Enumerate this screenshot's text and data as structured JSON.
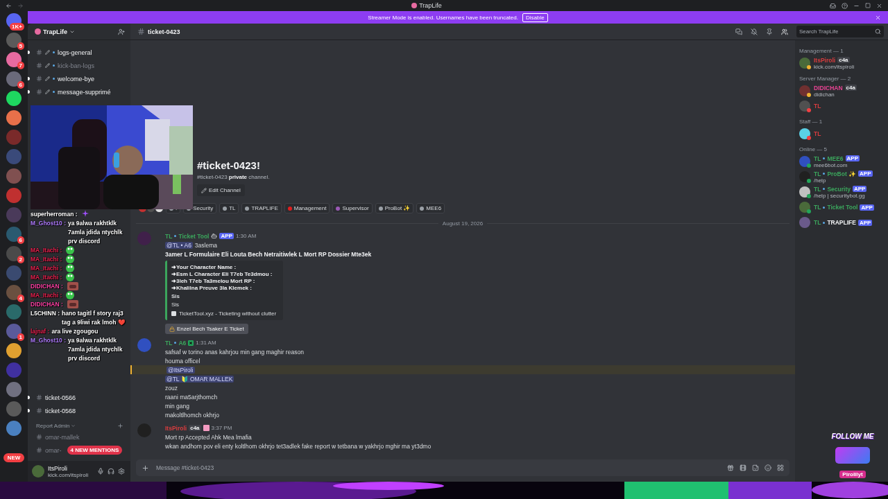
{
  "window": {
    "title": "TrapLife"
  },
  "banner": {
    "text": "Streamer Mode is enabled. Usernames have been truncated.",
    "button": "Disable"
  },
  "servers": [
    {
      "kind": "home",
      "badge": "1K+"
    },
    {
      "kind": "server",
      "badge": "5"
    },
    {
      "kind": "server",
      "badge": "7"
    },
    {
      "kind": "server",
      "badge": "6"
    },
    {
      "kind": "server"
    },
    {
      "kind": "server"
    },
    {
      "kind": "server"
    },
    {
      "kind": "server"
    },
    {
      "kind": "server"
    },
    {
      "kind": "server"
    },
    {
      "kind": "server"
    },
    {
      "kind": "server",
      "badge": "6"
    },
    {
      "kind": "server",
      "badge": "2"
    },
    {
      "kind": "server"
    },
    {
      "kind": "server",
      "badge": "4"
    },
    {
      "kind": "server"
    },
    {
      "kind": "server",
      "badge": "1"
    },
    {
      "kind": "server"
    },
    {
      "kind": "server"
    },
    {
      "kind": "server"
    },
    {
      "kind": "server"
    },
    {
      "kind": "server"
    }
  ],
  "new_pill": "NEW",
  "sidebar": {
    "server": "TrapLife",
    "channels_top": [
      {
        "name": "logs-general",
        "unread": true
      },
      {
        "name": "kick-ban-logs",
        "unread": false
      },
      {
        "name": "welcome-bye",
        "unread": true
      },
      {
        "name": "message-supprimé",
        "unread": true
      }
    ],
    "channels_bottom": [
      {
        "name": "ticket-0566",
        "unread": true
      },
      {
        "name": "ticket-0568",
        "unread": true
      }
    ],
    "category": "Report Admin",
    "category_channels": [
      {
        "name": "omar-mallek",
        "unread": false
      },
      {
        "name": "omar-",
        "unread": false
      }
    ],
    "mentions_pill": "4 NEW MENTIONS"
  },
  "user_panel": {
    "name": "ItsPiroli",
    "status": "kick.com/itspiroli"
  },
  "header": {
    "channel": "ticket-0423",
    "search_placeholder": "Search TrapLife"
  },
  "welcome": {
    "title": "#ticket-0423!",
    "text": "#ticket-0423 **private** channel.",
    "button": "Edit Channel"
  },
  "roles": [
    {
      "name": ".",
      "color": "#9aa0a6"
    },
    {
      "name": "Security",
      "color": "#9aa0a6"
    },
    {
      "name": "TL",
      "color": "#9aa0a6"
    },
    {
      "name": "TRAPLIFE",
      "color": "#9aa0a6"
    },
    {
      "name": "Management",
      "color": "#e01e1e"
    },
    {
      "name": "Supervisor",
      "color": "#9b59b6"
    },
    {
      "name": "ProBot ✨",
      "color": "#9aa0a6"
    },
    {
      "name": "MEE6",
      "color": "#9aa0a6"
    }
  ],
  "date": "August 19, 2026",
  "messages": [
    {
      "kind": "bot",
      "tag": "TL",
      "name": "Ticket Tool",
      "color": "#3ba55c",
      "app": "APP",
      "time": "1:30 AM",
      "lines": [
        {
          "kind": "mention",
          "mention": "@TL • A6",
          "text": "3aslema",
          "highlighted": false
        },
        {
          "kind": "bold",
          "text": "3amer L Formulaire Eli Louta Bech Netraitiwlek L Mort RP Dossier Mte3ek"
        }
      ],
      "embed": {
        "fields": [
          "➜Your Character Name :",
          "➜Esm L Character Eli T7eb Te3dmou :",
          "➜3leh T7eb Ta3melou Mort RP :",
          "➜Khalilna Preuve 3la Klemek :"
        ],
        "value_bold": "Sis",
        "value": "Sis",
        "footer": "TicketTool.xyz - Ticketing without clutter"
      },
      "button": "Enzel Bech Tsaker E Ticket"
    },
    {
      "kind": "staff",
      "tag": "TL",
      "name": "A6",
      "color": "#3ba55c",
      "time": "1:31 AM",
      "lines": [
        {
          "kind": "text",
          "text": "safsaf w torino anas kahrjou min gang maghir reason"
        },
        {
          "kind": "text",
          "text": "houma officel"
        },
        {
          "kind": "mention",
          "mention": "@ItsPiroli",
          "highlighted": true
        },
        {
          "kind": "mention",
          "mention": "@TL 🔰 OMAR MALLEK",
          "highlighted": false
        },
        {
          "kind": "text",
          "text": "zouz"
        },
        {
          "kind": "text",
          "text": "raani ma5arjthomch"
        },
        {
          "kind": "text",
          "text": "min gang"
        },
        {
          "kind": "text",
          "text": "makoltlhomch okhrjo"
        }
      ]
    },
    {
      "kind": "user",
      "name": "ItsPiroli",
      "color": "#d83c3e",
      "guild_tag": "c4a",
      "time": "3:37 PM",
      "lines": [
        {
          "kind": "text",
          "text": "Mort rp Accepted Ahk Mea lmafia"
        },
        {
          "kind": "text",
          "text": "wkan andhom pov eli enty koltlhom okhrjo tet3adlek fake report w tetbana w yakhrjo mghir ma yt3dmo"
        }
      ]
    }
  ],
  "input_placeholder": "Message #ticket-0423",
  "member_groups": [
    {
      "title": "Management — 1",
      "members": [
        {
          "name": "ItsPiroli",
          "color": "#d83c3e",
          "guild_tag": "c4a",
          "status": "kick.com/itspiroli",
          "presence": {
            "color": "#f0b232"
          }
        }
      ]
    },
    {
      "title": "Server Manager — 2",
      "members": [
        {
          "name": "DIDICHAN",
          "color": "#e84393",
          "guild_tag": "c4a",
          "status": "didichan",
          "presence": {
            "color": "#f0b232"
          }
        },
        {
          "prefix": "TL",
          "color": "#d83c3e",
          "presence": {
            "color": "#f23f43"
          }
        }
      ]
    },
    {
      "title": "Staff — 1",
      "members": [
        {
          "prefix": "TL",
          "color": "#d83c3e",
          "presence": {
            "color": "#f23f43"
          }
        }
      ]
    },
    {
      "title": "Online — 5",
      "members": [
        {
          "prefix": "TL",
          "name": "MEE6",
          "color": "#3ba55c",
          "app": "APP",
          "status": "mee6bot.com",
          "presence": {
            "color": "#23a55a"
          }
        },
        {
          "prefix": "TL",
          "name": "ProBot ✨",
          "color": "#3ba55c",
          "app": "APP",
          "status": "/help",
          "presence": {
            "color": "#23a55a"
          }
        },
        {
          "prefix": "TL",
          "name": "Security",
          "color": "#3ba55c",
          "app": "APP",
          "status": "/help | securitybot.gg",
          "presence": {
            "color": "#23a55a"
          }
        },
        {
          "prefix": "TL",
          "name": "Ticket Tool",
          "color": "#3ba55c",
          "app": "APP",
          "presence": {
            "color": "#23a55a"
          }
        },
        {
          "prefix": "TL",
          "name": "TRAPLIFE",
          "color": "#f2f3f5",
          "app": "APP"
        }
      ]
    }
  ],
  "stream_chat": [
    {
      "user": "superherroman :",
      "color": "#ffffff",
      "emote": {
        "kind": "sparkle"
      }
    },
    {
      "user": "M_Ghost10 :",
      "color": "#b07cff",
      "text": "ya 9alwa rakhtklk 7amla jdida ntychlk prv discord"
    },
    {
      "user": "MA_Itachi :",
      "color": "#e8214f",
      "emote": {
        "kind": "frog"
      }
    },
    {
      "user": "MA_Itachi :",
      "color": "#e8214f",
      "emote": {
        "kind": "frog"
      }
    },
    {
      "user": "MA_Itachi :",
      "color": "#e8214f",
      "emote": {
        "kind": "frog"
      }
    },
    {
      "user": "MA_Itachi :",
      "color": "#e8214f",
      "emote": {
        "kind": "frog"
      }
    },
    {
      "user": "DIDICHAN :",
      "color": "#ff3fa4",
      "emote": {
        "kind": "face"
      }
    },
    {
      "user": "MA_Itachi :",
      "color": "#e8214f",
      "emote": {
        "kind": "frog"
      }
    },
    {
      "user": "DIDICHAN :",
      "color": "#ff3fa4",
      "emote": {
        "kind": "face"
      }
    },
    {
      "user": "L5CHINN :",
      "color": "#ffffff",
      "text": "hano tagitl f story raj3 tag a 9liwi rak lmoh ❤️"
    },
    {
      "user": "lajnaf :",
      "color": "#e8214f",
      "text": "ara live zgougou"
    },
    {
      "user": "M_Ghost10 :",
      "color": "#b07cff",
      "text": "ya 9alwa rakhtklk 7amla jdida ntychlk prv discord"
    }
  ],
  "follow_badge": {
    "title": "FOLLOW ME",
    "handle": "Pirolilyt"
  }
}
